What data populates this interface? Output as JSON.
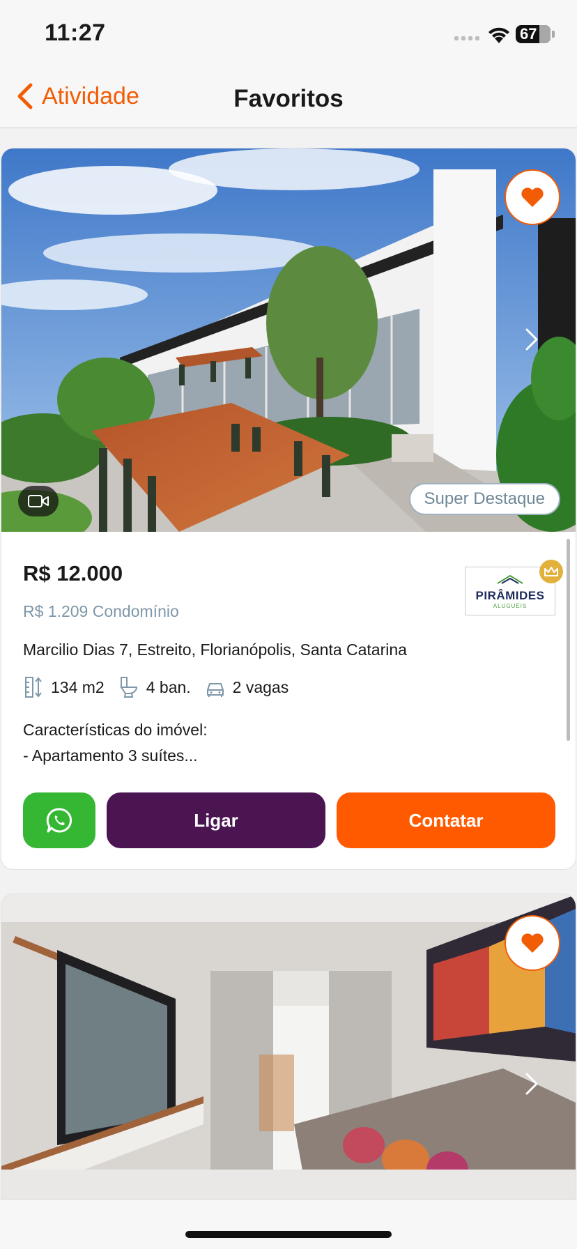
{
  "status_bar": {
    "time": "11:27",
    "battery": "67"
  },
  "nav": {
    "back_label": "Atividade",
    "title": "Favoritos"
  },
  "listings": [
    {
      "badge": "Super Destaque",
      "price": "R$ 12.000",
      "condo_fee": "R$ 1.209 Condomínio",
      "agency": {
        "name": "PIRÂMIDES",
        "sub": "ALUGUÉIS"
      },
      "address": "Marcilio Dias 7, Estreito, Florianópolis, Santa Catarina",
      "features": {
        "area": "134 m2",
        "bathrooms": "4  ban.",
        "parking": "2 vagas"
      },
      "description_title": "Características do imóvel:",
      "description_snippet": "- Apartamento 3 suítes...",
      "actions": {
        "call_label": "Ligar",
        "contact_label": "Contatar"
      }
    },
    {
      "favorited": true
    }
  ],
  "colors": {
    "accent": "#f25c05",
    "whatsapp": "#35b734",
    "call": "#4b1552",
    "contact": "#ff5a00",
    "badge_text": "#6f8796"
  },
  "icons": [
    "chevron-left-icon",
    "heart-icon",
    "chevron-right-icon",
    "video-icon",
    "crown-icon",
    "ruler-icon",
    "toilet-icon",
    "car-icon",
    "whatsapp-icon"
  ]
}
